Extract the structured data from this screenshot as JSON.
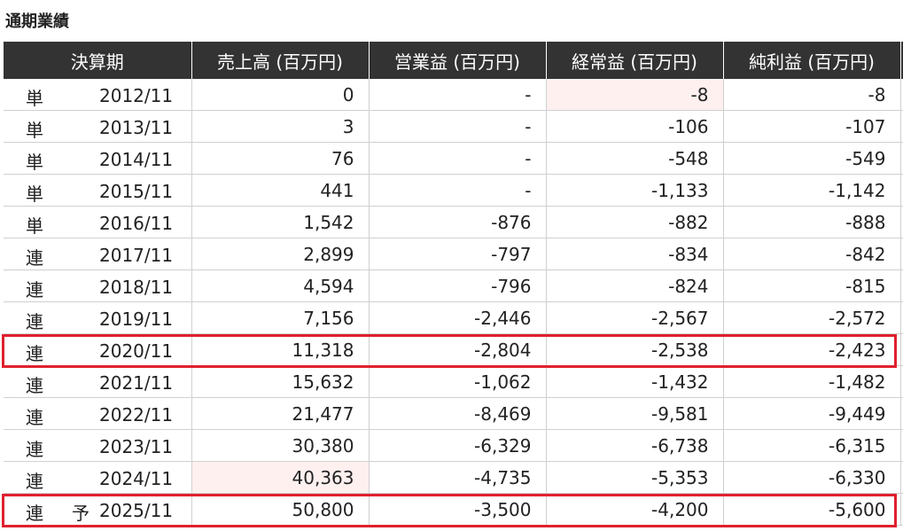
{
  "title": "通期業績",
  "headers": [
    "決算期",
    "売上高 (百万円)",
    "営業益 (百万円)",
    "経常益 (百万円)",
    "純利益 (百万円)"
  ],
  "rows": [
    {
      "kind": "単",
      "forecast": "",
      "period": "2012/11",
      "sales": "0",
      "op": "-",
      "ord": "-8",
      "net": "-8"
    },
    {
      "kind": "単",
      "forecast": "",
      "period": "2013/11",
      "sales": "3",
      "op": "-",
      "ord": "-106",
      "net": "-107"
    },
    {
      "kind": "単",
      "forecast": "",
      "period": "2014/11",
      "sales": "76",
      "op": "-",
      "ord": "-548",
      "net": "-549"
    },
    {
      "kind": "単",
      "forecast": "",
      "period": "2015/11",
      "sales": "441",
      "op": "-",
      "ord": "-1,133",
      "net": "-1,142"
    },
    {
      "kind": "単",
      "forecast": "",
      "period": "2016/11",
      "sales": "1,542",
      "op": "-876",
      "ord": "-882",
      "net": "-888"
    },
    {
      "kind": "連",
      "forecast": "",
      "period": "2017/11",
      "sales": "2,899",
      "op": "-797",
      "ord": "-834",
      "net": "-842"
    },
    {
      "kind": "連",
      "forecast": "",
      "period": "2018/11",
      "sales": "4,594",
      "op": "-796",
      "ord": "-824",
      "net": "-815"
    },
    {
      "kind": "連",
      "forecast": "",
      "period": "2019/11",
      "sales": "7,156",
      "op": "-2,446",
      "ord": "-2,567",
      "net": "-2,572"
    },
    {
      "kind": "連",
      "forecast": "",
      "period": "2020/11",
      "sales": "11,318",
      "op": "-2,804",
      "ord": "-2,538",
      "net": "-2,423"
    },
    {
      "kind": "連",
      "forecast": "",
      "period": "2021/11",
      "sales": "15,632",
      "op": "-1,062",
      "ord": "-1,432",
      "net": "-1,482"
    },
    {
      "kind": "連",
      "forecast": "",
      "period": "2022/11",
      "sales": "21,477",
      "op": "-8,469",
      "ord": "-9,581",
      "net": "-9,449"
    },
    {
      "kind": "連",
      "forecast": "",
      "period": "2023/11",
      "sales": "30,380",
      "op": "-6,329",
      "ord": "-6,738",
      "net": "-6,315"
    },
    {
      "kind": "連",
      "forecast": "",
      "period": "2024/11",
      "sales": "40,363",
      "op": "-4,735",
      "ord": "-5,353",
      "net": "-6,330"
    },
    {
      "kind": "連",
      "forecast": "予",
      "period": "2025/11",
      "sales": "50,800",
      "op": "-3,500",
      "ord": "-4,200",
      "net": "-5,600"
    }
  ],
  "colors": {
    "header_bg": "#333333",
    "header_text": "#ffffff",
    "highlight_box": "#e0202e",
    "cell_highlight": "#fff0f0",
    "grid": "#d0d0d0"
  }
}
